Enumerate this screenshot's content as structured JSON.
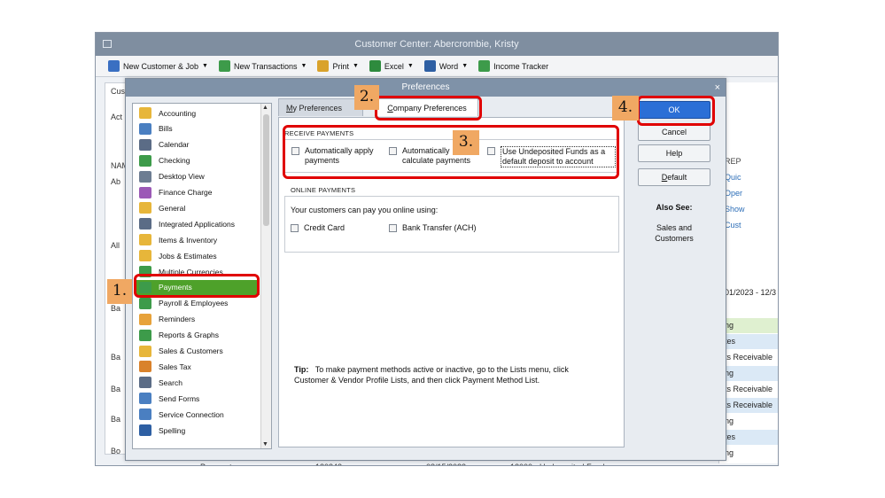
{
  "app": {
    "title": "Customer Center: Abercrombie, Kristy",
    "toolbar": [
      {
        "label": "New Customer & Job",
        "icon": "people-icon",
        "arrow": true
      },
      {
        "label": "New Transactions",
        "icon": "transactions-icon",
        "arrow": true
      },
      {
        "label": "Print",
        "icon": "printer-icon",
        "arrow": true
      },
      {
        "label": "Excel",
        "icon": "excel-icon",
        "arrow": true
      },
      {
        "label": "Word",
        "icon": "word-icon",
        "arrow": true
      },
      {
        "label": "Income Tracker",
        "icon": "income-tracker-icon",
        "arrow": false
      }
    ],
    "left_fragments": [
      "Cus",
      "Act",
      "NAM",
      "Ab",
      "All",
      "Ba",
      "Ba",
      "Ba",
      "Ba",
      "Bo"
    ],
    "right_fragments": {
      "date_range": "01/2023 - 12/3",
      "report_links": [
        "REP",
        "Quic",
        "Oper",
        "Show",
        "Cust"
      ],
      "rows": [
        "ng",
        "tes",
        "ts Receivable",
        "ng",
        "ts Receivable",
        "ts Receivable",
        "ng",
        "tes",
        "ng"
      ]
    },
    "bottom_row": [
      "Payment",
      "120242",
      "08/15/2023",
      "12000 · Undeposited Funds"
    ]
  },
  "dialog": {
    "title": "Preferences",
    "close_glyph": "×",
    "categories": [
      {
        "label": "Accounting",
        "icon": "accounting-icon",
        "color": "#e7b63a"
      },
      {
        "label": "Bills",
        "icon": "bills-icon",
        "color": "#4a7fc1"
      },
      {
        "label": "Calendar",
        "icon": "calendar-icon",
        "color": "#5b6c86"
      },
      {
        "label": "Checking",
        "icon": "checking-icon",
        "color": "#3d9b4a"
      },
      {
        "label": "Desktop View",
        "icon": "desktop-view-icon",
        "color": "#6d7d92"
      },
      {
        "label": "Finance Charge",
        "icon": "finance-charge-icon",
        "color": "#9b59b6"
      },
      {
        "label": "General",
        "icon": "general-icon",
        "color": "#e7b63a"
      },
      {
        "label": "Integrated Applications",
        "icon": "integrated-apps-icon",
        "color": "#5b6c86"
      },
      {
        "label": "Items & Inventory",
        "icon": "items-inventory-icon",
        "color": "#e7b63a"
      },
      {
        "label": "Jobs & Estimates",
        "icon": "jobs-estimates-icon",
        "color": "#e7b63a"
      },
      {
        "label": "Multiple Currencies",
        "icon": "multiple-currencies-icon",
        "color": "#3d9b4a"
      },
      {
        "label": "Payments",
        "icon": "payments-icon",
        "color": "#3d9b4a",
        "selected": true
      },
      {
        "label": "Payroll & Employees",
        "icon": "payroll-icon",
        "color": "#3d9b4a"
      },
      {
        "label": "Reminders",
        "icon": "reminders-icon",
        "color": "#e7a23a"
      },
      {
        "label": "Reports & Graphs",
        "icon": "reports-graphs-icon",
        "color": "#3d9b4a"
      },
      {
        "label": "Sales & Customers",
        "icon": "sales-customers-icon",
        "color": "#e7b63a"
      },
      {
        "label": "Sales Tax",
        "icon": "sales-tax-icon",
        "color": "#d9822b"
      },
      {
        "label": "Search",
        "icon": "search-icon",
        "color": "#5b6c86"
      },
      {
        "label": "Send Forms",
        "icon": "send-forms-icon",
        "color": "#4a7fc1"
      },
      {
        "label": "Service Connection",
        "icon": "service-connection-icon",
        "color": "#4a7fc1"
      },
      {
        "label": "Spelling",
        "icon": "spelling-icon",
        "color": "#2e5fa3"
      }
    ],
    "tabs": {
      "my_prefix": "M",
      "my_rest": "y Preferences",
      "company_prefix": "C",
      "company_rest": "ompany Preferences"
    },
    "receive_payments": {
      "title": "RECEIVE PAYMENTS",
      "auto_apply": "Automatically apply payments",
      "auto_calc": "Automatically calculate payments",
      "undeposited": "Use Undeposited Funds as a default deposit to account"
    },
    "online_payments": {
      "title": "ONLINE PAYMENTS",
      "intro": "Your customers can pay you online using:",
      "credit_card": "Credit Card",
      "bank_transfer": "Bank Transfer (ACH)"
    },
    "tip": {
      "label": "Tip:",
      "text": "To make payment methods active or inactive, go to the Lists menu, click Customer & Vendor Profile Lists, and then click Payment Method List."
    },
    "buttons": {
      "ok": "OK",
      "cancel": "Cancel",
      "help": "Help",
      "default": "Default"
    },
    "also_see": {
      "title": "Also See:",
      "link": "Sales and Customers"
    }
  },
  "annotations": {
    "step1": "1.",
    "step2": "2.",
    "step3": "3.",
    "step4": "4.",
    "highlight_color": "#e00000",
    "badge_color": "#f0a863"
  }
}
